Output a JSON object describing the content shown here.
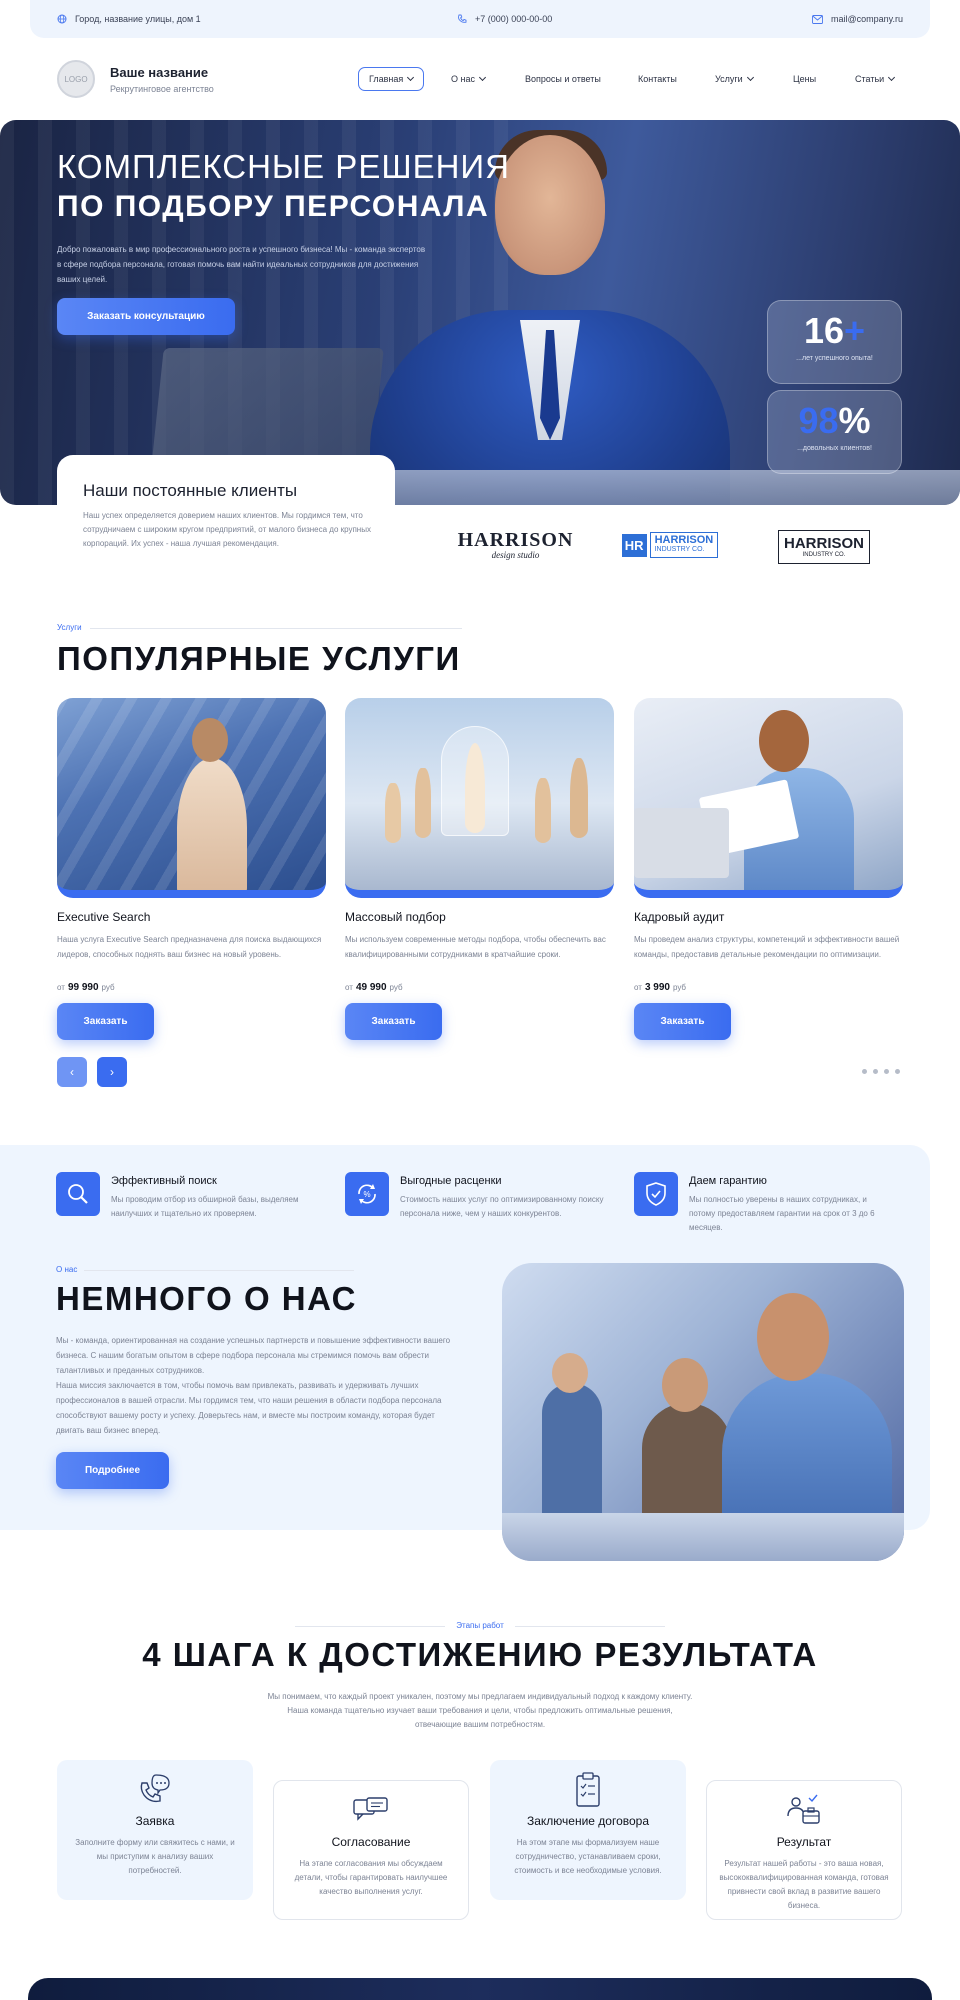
{
  "topbar": {
    "address": "Город, название улицы, дом 1",
    "phone": "+7 (000) 000-00-00",
    "email": "mail@company.ru"
  },
  "header": {
    "logo_text": "LOGO",
    "brand_name": "Ваше название",
    "brand_sub": "Рекрутинговое агентство",
    "nav": [
      {
        "label": "Главная",
        "dropdown": true,
        "active": true
      },
      {
        "label": "О нас",
        "dropdown": true
      },
      {
        "label": "Вопросы и ответы"
      },
      {
        "label": "Контакты"
      },
      {
        "label": "Услуги",
        "dropdown": true
      },
      {
        "label": "Цены"
      },
      {
        "label": "Статьи",
        "dropdown": true
      }
    ]
  },
  "hero": {
    "title_line1": "КОМПЛЕКСНЫЕ РЕШЕНИЯ",
    "title_line2": "ПО ПОДБОРУ ПЕРСОНАЛА",
    "description": "Добро пожаловать в мир профессионального роста и успешного бизнеса! Мы - команда экспертов в сфере подбора персонала, готовая помочь вам найти идеальных сотрудников для достижения ваших целей.",
    "cta_label": "Заказать консультацию",
    "stats": [
      {
        "value": "16",
        "accent": "+",
        "label": "...лет успешного опыта!"
      },
      {
        "value_accent": "98",
        "value": "%",
        "label": "...довольных клиентов!"
      }
    ]
  },
  "clients": {
    "title": "Наши постоянные клиенты",
    "description": "Наш успех определяется доверием наших клиентов. Мы гордимся тем, что сотрудничаем с широким кругом предприятий, от малого бизнеса до крупных корпораций. Их успех - наша лучшая рекомендация.",
    "logos": [
      {
        "word": "HARRISON",
        "sub": "design studio"
      },
      {
        "mark": "HR",
        "word": "HARRISON",
        "sub": "INDUSTRY CO."
      },
      {
        "word": "HARRISON",
        "sub": "INDUSTRY CO."
      }
    ]
  },
  "services": {
    "eyebrow": "Услуги",
    "title": "ПОПУЛЯРНЫЕ УСЛУГИ",
    "price_prefix": "от",
    "currency": "руб",
    "order_label": "Заказать",
    "cards": [
      {
        "title": "Executive Search",
        "description": "Наша услуга Executive Search предназначена для поиска выдающихся лидеров, способных поднять ваш бизнес на новый уровень.",
        "price": "99 990"
      },
      {
        "title": "Массовый подбор",
        "description": "Мы используем современные методы подбора, чтобы обеспечить вас квалифицированными сотрудниками в кратчайшие сроки.",
        "price": "49 990"
      },
      {
        "title": "Кадровый аудит",
        "description": "Мы проведем анализ структуры, компетенций и эффективности вашей команды, предоставив детальные рекомендации по оптимизации.",
        "price": "3 990"
      }
    ],
    "slider": {
      "prev": "‹",
      "next": "›",
      "dots": 4
    }
  },
  "features": [
    {
      "title": "Эффективный поиск",
      "description": "Мы проводим отбор из обширной базы, выделяем наилучших и тщательно их проверяем.",
      "icon": "search-icon"
    },
    {
      "title": "Выгодные расценки",
      "description": "Стоимость наших услуг по оптимизированному поиску персонала ниже, чем у наших конкурентов.",
      "icon": "price-icon"
    },
    {
      "title": "Даем гарантию",
      "description": "Мы полностью уверены в наших сотрудниках, и потому предоставляем гарантии на срок от 3 до 6 месяцев.",
      "icon": "shield-icon"
    }
  ],
  "about": {
    "eyebrow": "О нас",
    "title": "НЕМНОГО О НАС",
    "paragraph1": "Мы - команда, ориентированная на создание успешных партнерств и повышение эффективности вашего бизнеса. С нашим богатым опытом в сфере подбора персонала мы стремимся помочь вам обрести талантливых и преданных сотрудников.",
    "paragraph2": "Наша миссия заключается в том, чтобы помочь вам привлекать, развивать и удерживать лучших профессионалов в вашей отрасли. Мы гордимся тем, что наши решения в области подбора персонала способствуют вашему росту и успеху. Доверьтесь нам, и вместе мы построим команду, которая будет двигать ваш бизнес вперед.",
    "button_label": "Подробнее"
  },
  "steps": {
    "eyebrow": "Этапы работ",
    "title": "4 ШАГА К ДОСТИЖЕНИЮ РЕЗУЛЬТАТА",
    "description": "Мы понимаем, что каждый проект уникален, поэтому мы предлагаем индивидуальный подход к каждому клиенту. Наша команда тщательно изучает ваши требования и цели, чтобы предложить оптимальные решения, отвечающие вашим потребностям.",
    "items": [
      {
        "title": "Заявка",
        "description": "Заполните форму или свяжитесь с нами, и мы приступим к анализу ваших потребностей.",
        "icon": "phone-chat-icon"
      },
      {
        "title": "Согласование",
        "description": "На этапе согласования мы обсуждаем детали, чтобы гарантировать наилучшее качество выполнения услуг.",
        "icon": "chat-bubbles-icon"
      },
      {
        "title": "Заключение договора",
        "description": "На этом этапе мы формализуем наше сотрудничество, устанавливаем сроки, стоимость и все необходимые условия.",
        "icon": "clipboard-icon"
      },
      {
        "title": "Результат",
        "description": "Результат нашей работы - это ваша новая, высококвалифицированная команда, готовая привнести свой вклад в развитие вашего бизнеса.",
        "icon": "team-result-icon"
      }
    ]
  },
  "colors": {
    "accent": "#3a6cf0",
    "light_bg": "#eef5fe",
    "dark": "#10131c"
  }
}
